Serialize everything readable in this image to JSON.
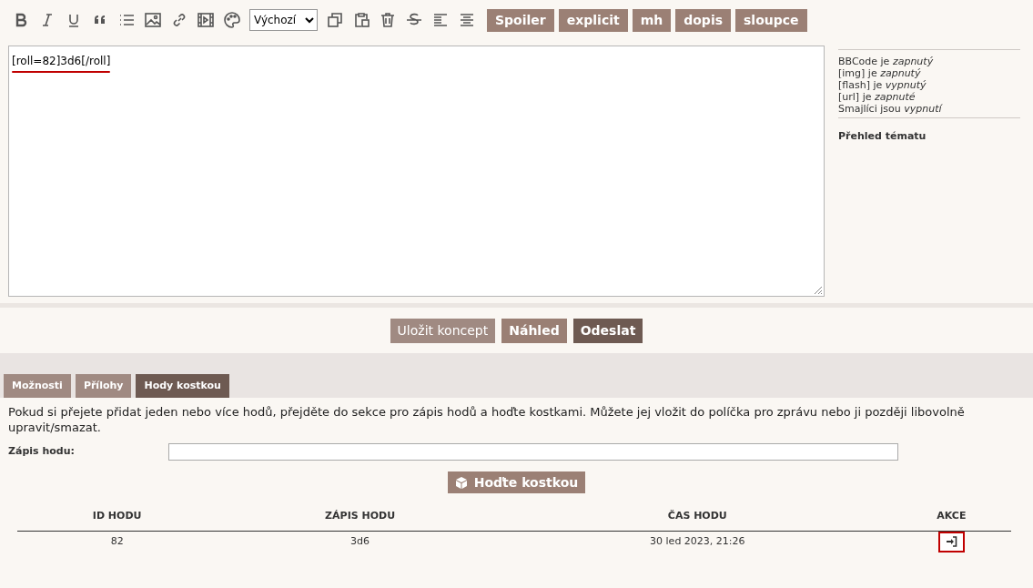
{
  "toolbar": {
    "icons": [
      {
        "kind": "bold"
      },
      {
        "kind": "italic"
      },
      {
        "kind": "underline"
      },
      {
        "kind": "quote"
      },
      {
        "kind": "list"
      },
      {
        "kind": "image"
      },
      {
        "kind": "link"
      },
      {
        "kind": "video"
      },
      {
        "kind": "palette"
      },
      {
        "kind": "select",
        "value": "Výchozí"
      },
      {
        "kind": "copy"
      },
      {
        "kind": "paste"
      },
      {
        "kind": "trash"
      },
      {
        "kind": "strike"
      },
      {
        "kind": "align-left"
      },
      {
        "kind": "align-center"
      }
    ],
    "tag_buttons": [
      "Spoiler",
      "explicit",
      "mh",
      "dopis",
      "sloupce"
    ]
  },
  "editor": {
    "value": "[roll=82]3d6[/roll]"
  },
  "sidebar": {
    "status_lines": [
      "BBCode je *zapnutý*",
      "[img] je *zapnutý*",
      "[flash] je *vypnutý*",
      "[url] je *zapnuté*",
      "Smajlíci jsou *vypnutí*"
    ],
    "heading": "Přehled tématu"
  },
  "actions": [
    {
      "label": "Uložit koncept",
      "kind": "secondary"
    },
    {
      "label": "Náhled",
      "kind": "preview"
    },
    {
      "label": "Odeslat",
      "kind": "primary"
    }
  ],
  "tabs": [
    {
      "label": "Možnosti",
      "selected": false
    },
    {
      "label": "Přílohy",
      "selected": false
    },
    {
      "label": "Hody kostkou",
      "selected": true
    }
  ],
  "dice": {
    "description": "Pokud si přejete přidat jeden nebo více hodů, přejděte do sekce pro zápis hodů a hoďte kostkami. Můžete jej vložit do políčka pro zprávu nebo ji později libovolně upravit/smazat.",
    "field_label": "Zápis hodu:",
    "roll_button": "Hoďte kostkou",
    "table": {
      "columns": [
        "ID HODU",
        "ZÁPIS HODU",
        "ČAS HODU",
        "AKCE"
      ],
      "rows": [
        [
          "82",
          "3d6",
          "30 led 2023, 21:26"
        ]
      ]
    }
  }
}
